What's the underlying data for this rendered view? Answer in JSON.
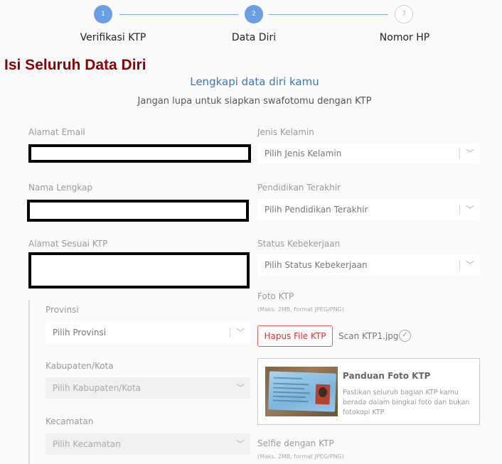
{
  "stepper": {
    "steps": [
      {
        "number": "1",
        "label": "Verifikasi KTP",
        "state": "done"
      },
      {
        "number": "2",
        "label": "Data Diri",
        "state": "active"
      },
      {
        "number": "3",
        "label": "Nomor HP",
        "state": "todo"
      }
    ]
  },
  "overlay_title": "Isi Seluruh Data Diri",
  "header": {
    "subtitle": "Lengkapi data diri kamu",
    "hint": "Jangan lupa untuk siapkan swafotomu dengan KTP"
  },
  "form_left": {
    "email_label": "Alamat Email",
    "name_label": "Nama Lengkap",
    "address_label": "Alamat Sesuai KTP",
    "province_label": "Provinsi",
    "province_placeholder": "Pilih Provinsi",
    "city_label": "Kabupaten/Kota",
    "city_placeholder": "Pilih Kabupaten/Kota",
    "district_label": "Kecamatan",
    "district_placeholder": "Pilih Kecamatan"
  },
  "form_right": {
    "gender_label": "Jenis Kelamin",
    "gender_placeholder": "Pilih Jenis Kelamin",
    "education_label": "Pendidikan Terakhir",
    "education_placeholder": "Pilih Pendidikan Terakhir",
    "employment_label": "Status Kebekerjaan",
    "employment_placeholder": "Pilih Status Kebekerjaan",
    "ktp_photo_label": "Foto KTP",
    "ktp_photo_hint": "(Maks. 2MB, format JPEG/PNG)",
    "delete_file_label": "Hapus File KTP",
    "file_name": "Scan KTP1.jpg",
    "guide_title": "Panduan Foto KTP",
    "guide_text": "Pastikan seluruh bagian KTP kamu berada dalam bingkai foto dan bukan fotokopi KTP",
    "selfie_label": "Selfie dengan KTP",
    "selfie_hint": "(Maks. 2MB, format JPEG/PNG)"
  },
  "icons": {
    "chevron": "chevron-down-icon",
    "check": "check-circle-icon"
  },
  "colors": {
    "accent_blue": "#3a75c4",
    "step_blue": "#6a9fe3",
    "danger_red": "#d93333",
    "overlay_title": "#8b0000"
  }
}
